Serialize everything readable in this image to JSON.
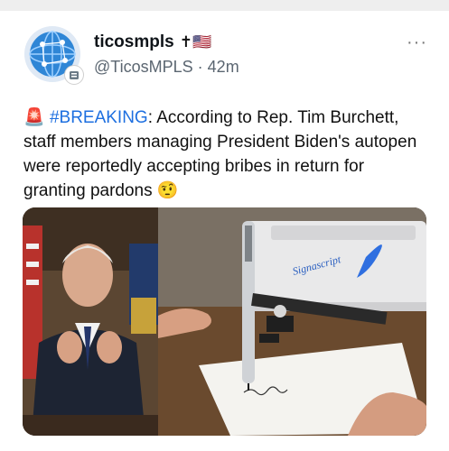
{
  "author": {
    "display_name": "ticosmpls",
    "name_emoji": "✝🇺🇸",
    "handle": "@TicosMPLS",
    "separator": "·",
    "time": "42m"
  },
  "menu": {
    "more_label": "···"
  },
  "post": {
    "alert_emoji": "🚨",
    "hashtag": "#BREAKING",
    "text": ": According to Rep. Tim Burchett, staff members managing President Biden's autopen were reportedly accepting bribes in return for granting pardons",
    "end_emoji": "🤨"
  },
  "media": {
    "brand_text": "Signascript"
  },
  "colors": {
    "hashtag": "#1d6fe0",
    "handle": "#5b6671",
    "topbar": "#eeeeee"
  }
}
